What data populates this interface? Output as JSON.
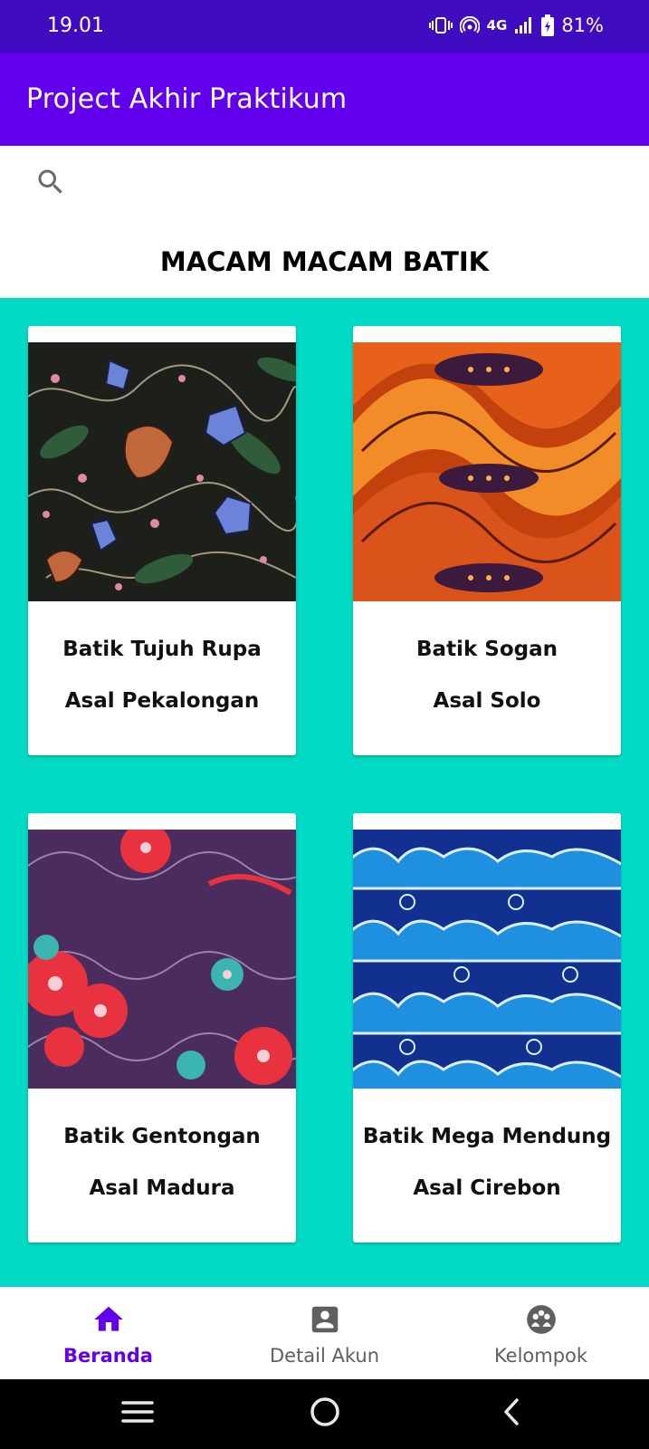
{
  "status_bar": {
    "time": "19.01",
    "network": "4G",
    "battery": "81%"
  },
  "app_bar": {
    "title": "Project Akhir Praktikum"
  },
  "search": {
    "icon": "search-icon"
  },
  "heading": "MACAM MACAM BATIK",
  "colors": {
    "status_bar": "#3f0cbf",
    "app_bar": "#6200ee",
    "grid_bg": "#03dac5",
    "nav_active": "#6200ee"
  },
  "cards": [
    {
      "name": "Batik Tujuh Rupa",
      "origin": "Asal Pekalongan",
      "pattern": "dark floral batik"
    },
    {
      "name": "Batik Sogan",
      "origin": "Asal Solo",
      "pattern": "orange wave batik"
    },
    {
      "name": "Batik Gentongan",
      "origin": "Asal Madura",
      "pattern": "purple red floral batik"
    },
    {
      "name": "Batik Mega Mendung",
      "origin": "Asal Cirebon",
      "pattern": "blue cloud batik"
    }
  ],
  "bottom_nav": [
    {
      "label": "Beranda",
      "icon": "home-icon",
      "active": true
    },
    {
      "label": "Detail Akun",
      "icon": "account-box-icon",
      "active": false
    },
    {
      "label": "Kelompok",
      "icon": "group-icon",
      "active": false
    }
  ],
  "system_nav": {
    "menu": "recent-apps-icon",
    "home": "home-circle-icon",
    "back": "back-icon"
  }
}
